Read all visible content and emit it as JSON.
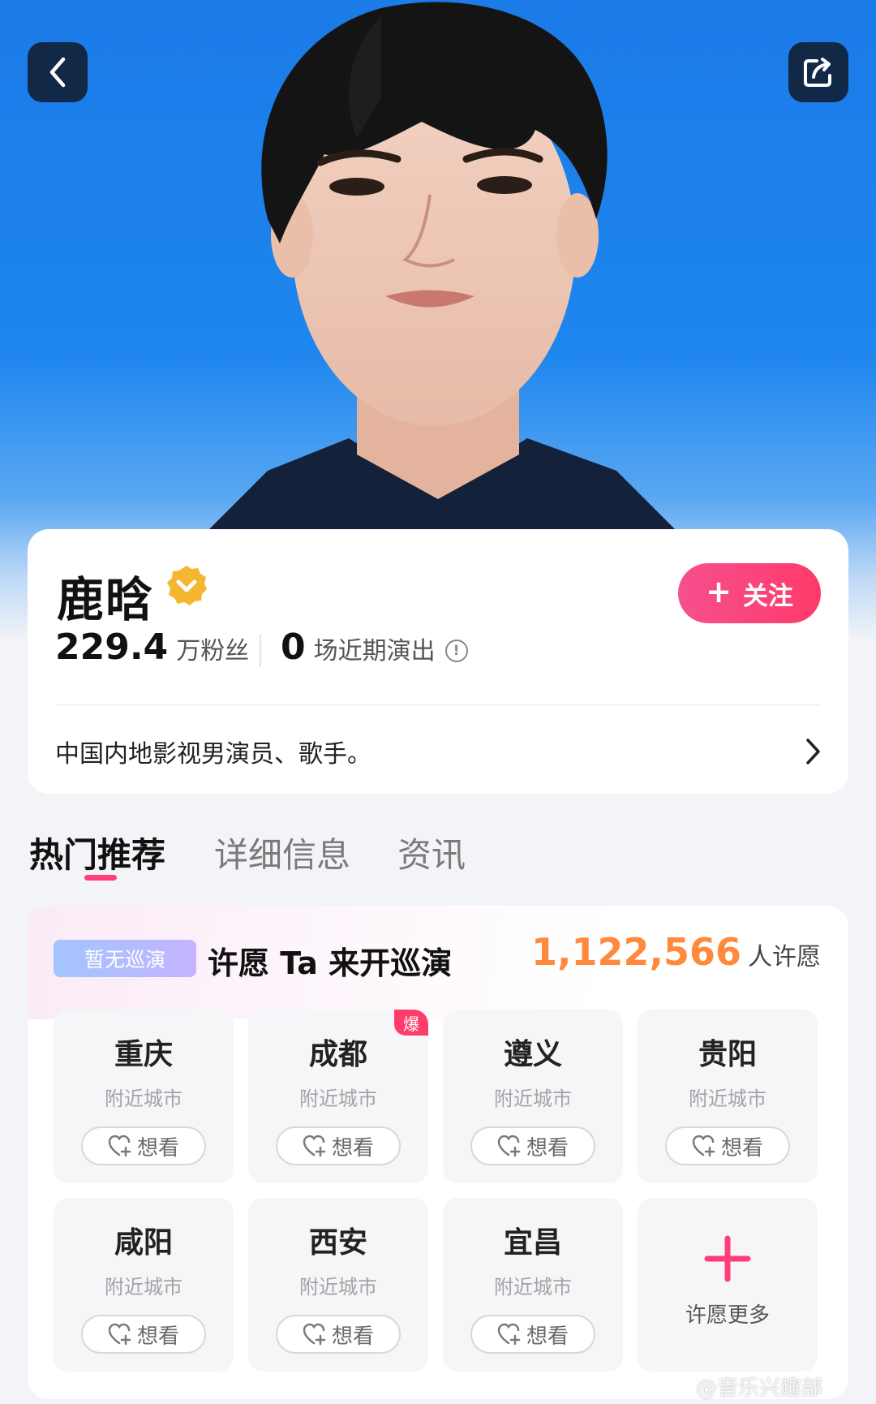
{
  "header": {
    "back_icon": "chevron-left-icon",
    "share_icon": "share-icon"
  },
  "artist": {
    "name": "鹿晗",
    "verified_icon": "verified-badge-icon",
    "follow_label": "关注",
    "fans_count": "229.4",
    "fans_label": "万粉丝",
    "shows_count": "0",
    "shows_label": "场近期演出",
    "bio": "中国内地影视男演员、歌手。"
  },
  "tabs": [
    {
      "label": "热门推荐",
      "active": true
    },
    {
      "label": "详细信息",
      "active": false
    },
    {
      "label": "资讯",
      "active": false
    }
  ],
  "wish": {
    "badge": "暂无巡演",
    "title": "许愿 Ta 来开巡演",
    "count": "1,122,566",
    "count_label": "人许愿",
    "cities": [
      {
        "name": "重庆",
        "sub": "附近城市",
        "button": "想看",
        "hot": ""
      },
      {
        "name": "成都",
        "sub": "附近城市",
        "button": "想看",
        "hot": "爆"
      },
      {
        "name": "遵义",
        "sub": "附近城市",
        "button": "想看",
        "hot": ""
      },
      {
        "name": "贵阳",
        "sub": "附近城市",
        "button": "想看",
        "hot": ""
      },
      {
        "name": "咸阳",
        "sub": "附近城市",
        "button": "想看",
        "hot": ""
      },
      {
        "name": "西安",
        "sub": "附近城市",
        "button": "想看",
        "hot": ""
      },
      {
        "name": "宜昌",
        "sub": "附近城市",
        "button": "想看",
        "hot": ""
      }
    ],
    "more_label": "许愿更多"
  },
  "watermark": "@音乐兴趣部",
  "colors": {
    "accent_pink": "#ff3d78",
    "wish_orange": "#ff8a3d",
    "hero_blue": "#1b7be8"
  }
}
